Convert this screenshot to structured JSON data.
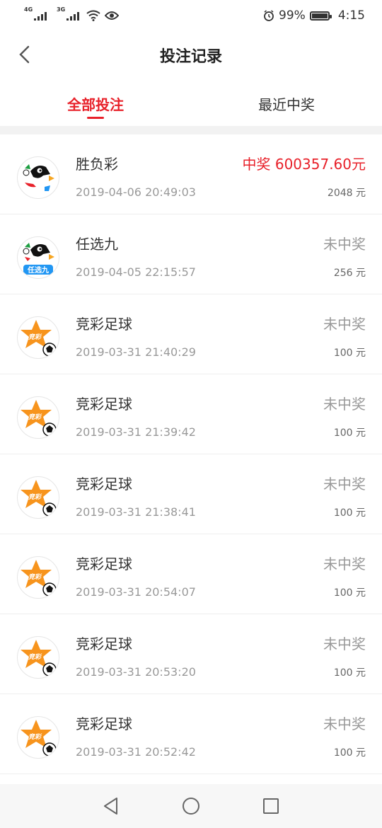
{
  "status_bar": {
    "net1": "4G",
    "net2": "3G",
    "battery_pct": "99%",
    "battery_level": 0.99,
    "time": "4:15"
  },
  "header": {
    "title": "投注记录"
  },
  "tabs": [
    {
      "label": "全部投注",
      "active": true
    },
    {
      "label": "最近中奖",
      "active": false
    }
  ],
  "records": [
    {
      "type": "胜负彩",
      "time": "2019-04-06 20:49:03",
      "status": "中奖 600357.60元",
      "win": true,
      "amount": "2048 元",
      "icon": "shengfucai-logo-icon"
    },
    {
      "type": "任选九",
      "time": "2019-04-05 22:15:57",
      "status": "未中奖",
      "win": false,
      "amount": "256 元",
      "icon": "renxuanjiu-logo-icon",
      "icon_text": "任选九"
    },
    {
      "type": "竞彩足球",
      "time": "2019-03-31 21:40:29",
      "status": "未中奖",
      "win": false,
      "amount": "100 元",
      "icon": "jingcai-logo-icon",
      "icon_text": "竞彩"
    },
    {
      "type": "竞彩足球",
      "time": "2019-03-31 21:39:42",
      "status": "未中奖",
      "win": false,
      "amount": "100 元",
      "icon": "jingcai-logo-icon",
      "icon_text": "竞彩"
    },
    {
      "type": "竞彩足球",
      "time": "2019-03-31 21:38:41",
      "status": "未中奖",
      "win": false,
      "amount": "100 元",
      "icon": "jingcai-logo-icon",
      "icon_text": "竞彩"
    },
    {
      "type": "竞彩足球",
      "time": "2019-03-31 20:54:07",
      "status": "未中奖",
      "win": false,
      "amount": "100 元",
      "icon": "jingcai-logo-icon",
      "icon_text": "竞彩"
    },
    {
      "type": "竞彩足球",
      "time": "2019-03-31 20:53:20",
      "status": "未中奖",
      "win": false,
      "amount": "100 元",
      "icon": "jingcai-logo-icon",
      "icon_text": "竞彩"
    },
    {
      "type": "竞彩足球",
      "time": "2019-03-31 20:52:42",
      "status": "未中奖",
      "win": false,
      "amount": "100 元",
      "icon": "jingcai-logo-icon",
      "icon_text": "竞彩"
    }
  ],
  "colors": {
    "accent": "#e8212a",
    "muted": "#999999"
  },
  "nav": {
    "icons": [
      "back-triangle-icon",
      "home-circle-icon",
      "recents-square-icon"
    ]
  }
}
